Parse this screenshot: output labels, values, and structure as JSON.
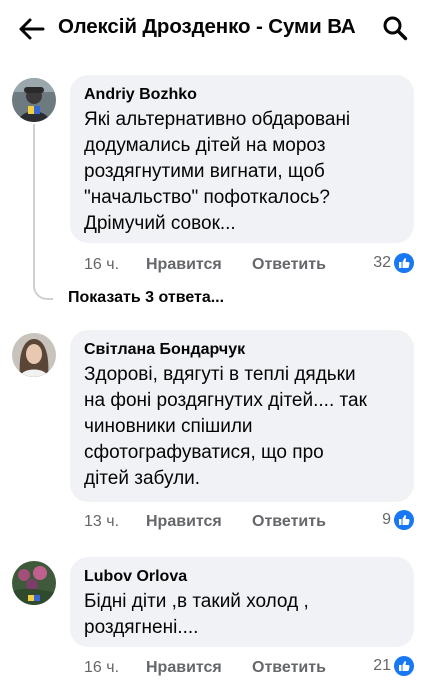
{
  "header": {
    "title": "Олексій Дрозденко - Суми ВА",
    "back_icon": "arrow-left-icon",
    "search_icon": "search-icon"
  },
  "colors": {
    "bubble": "#f0f2f5",
    "meta": "#65676b",
    "like": "#1877f2"
  },
  "comments": [
    {
      "author": "Andriy Bozhko",
      "text": "Які альтернативно обдаровані\nдодумались дітей на мороз\nроздягнутими вигнати, щоб\n\"начальство\" пофоткалось?\nДрімучий совок...",
      "time": "16 ч.",
      "like_label": "Нравится",
      "reply_label": "Ответить",
      "reactions": "32",
      "replies_label": "Показать 3 ответа..."
    },
    {
      "author": "Світлана Бондарчук",
      "text": "Здорові, вдягуті в теплі дядьки\nна фоні роздягнутих дітей.... так\nчиновники спішили\nсфотографуватися, що про\nдітей забули.",
      "time": "13 ч.",
      "like_label": "Нравится",
      "reply_label": "Ответить",
      "reactions": "9"
    },
    {
      "author": "Lubov Orlova",
      "text": "Бідні діти ,в такий холод ,\nроздягнені....",
      "time": "16 ч.",
      "like_label": "Нравится",
      "reply_label": "Ответить",
      "reactions": "21"
    }
  ]
}
